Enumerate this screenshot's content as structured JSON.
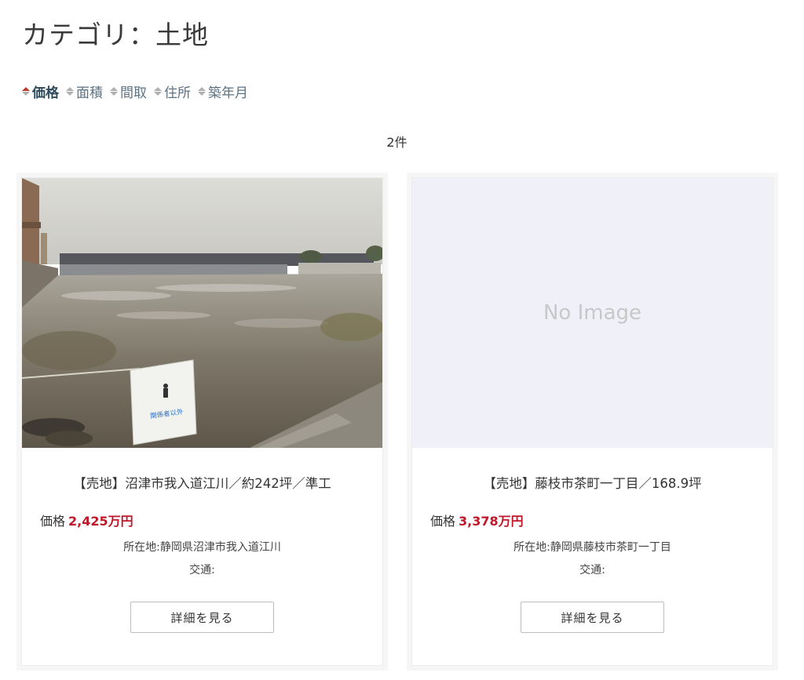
{
  "page": {
    "title": "カテゴリ：土地"
  },
  "sort": {
    "items": [
      {
        "label": "価格",
        "active": true
      },
      {
        "label": "面積",
        "active": false
      },
      {
        "label": "間取",
        "active": false
      },
      {
        "label": "住所",
        "active": false
      },
      {
        "label": "築年月",
        "active": false
      }
    ]
  },
  "results": {
    "count": "2件"
  },
  "listings": [
    {
      "title": "【売地】沼津市我入道江川／約242坪／準工",
      "price_label": "価格",
      "price": "2,425万円",
      "address": "所在地:静岡県沼津市我入道江川",
      "transport": "交通:",
      "button": "詳細を見る",
      "sign_text": "関係者以外"
    },
    {
      "title": "【売地】藤枝市茶町一丁目／168.9坪",
      "price_label": "価格",
      "price": "3,378万円",
      "address": "所在地:静岡県藤枝市茶町一丁目",
      "transport": "交通:",
      "button": "詳細を見る",
      "no_image_text": "No Image"
    }
  ],
  "colors": {
    "accent_price": "#c0182a",
    "sort_active_arrow": "#c0392b",
    "no_image_bg": "#f0f0f8"
  }
}
